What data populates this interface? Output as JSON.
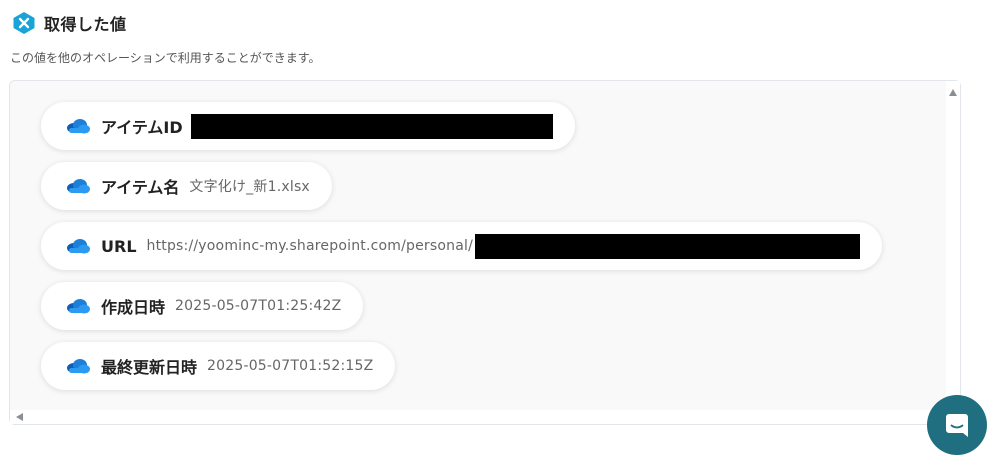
{
  "header": {
    "title": "取得した値",
    "logo_icon": "yoom-logo-icon"
  },
  "description": "この値を他のオペレーションで利用することができます。",
  "items": [
    {
      "label": "アイテムID",
      "value": "",
      "icon": "onedrive-cloud-icon",
      "redacted": true
    },
    {
      "label": "アイテム名",
      "value": "文字化け_新1.xlsx",
      "icon": "onedrive-cloud-icon",
      "redacted": false
    },
    {
      "label": "URL",
      "value": "https://yoominc-my.sharepoint.com/personal/",
      "icon": "onedrive-cloud-icon",
      "redacted": true
    },
    {
      "label": "作成日時",
      "value": "2025-05-07T01:25:42Z",
      "icon": "onedrive-cloud-icon",
      "redacted": false
    },
    {
      "label": "最終更新日時",
      "value": "2025-05-07T01:52:15Z",
      "icon": "onedrive-cloud-icon",
      "redacted": false
    }
  ],
  "chat": {
    "icon": "chat-bubble-icon"
  },
  "colors": {
    "accent": "#1a9bd7",
    "chat_button": "#1f6f80",
    "onedrive_blue": "#1e7fd8"
  }
}
